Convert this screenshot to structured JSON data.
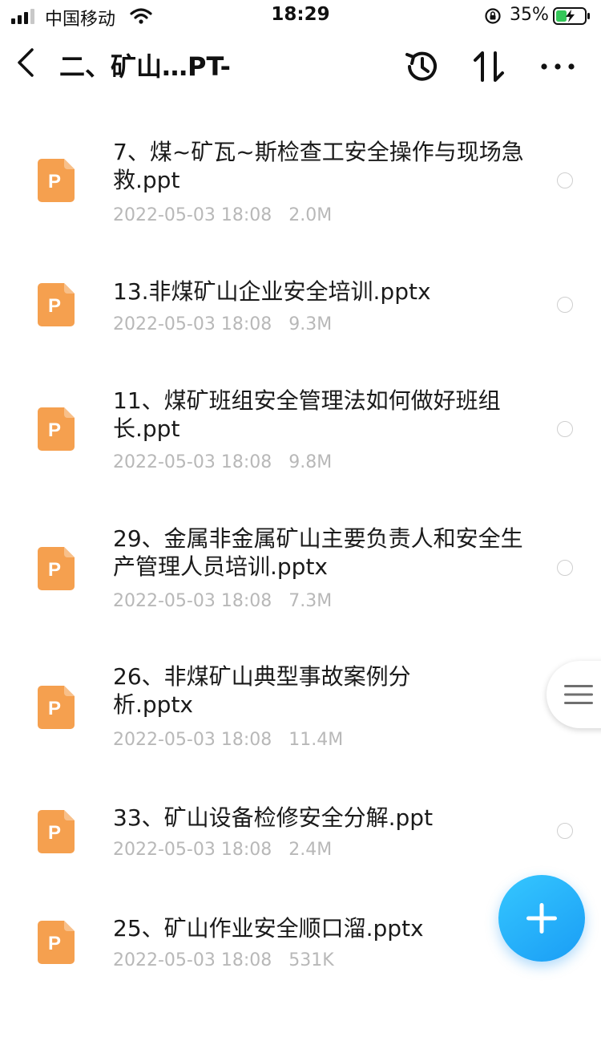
{
  "status_bar": {
    "carrier": "中国移动",
    "time": "18:29",
    "battery_percent": "35%",
    "icons": [
      "signal-icon",
      "wifi-icon",
      "orientation-lock-icon",
      "battery-charging-icon"
    ]
  },
  "nav": {
    "title": "二、矿山…PT-",
    "icons": [
      "back-chevron-icon",
      "history-icon",
      "sort-icon",
      "more-icon"
    ]
  },
  "files": [
    {
      "name": "7、煤~矿瓦~斯检查工安全操作与现场急救.ppt",
      "date": "2022-05-03 18:08",
      "size": "2.0M"
    },
    {
      "name": "13.非煤矿山企业安全培训.pptx",
      "date": "2022-05-03 18:08",
      "size": "9.3M"
    },
    {
      "name": "11、煤矿班组安全管理法如何做好班组长.ppt",
      "date": "2022-05-03 18:08",
      "size": "9.8M"
    },
    {
      "name": "29、金属非金属矿山主要负责人和安全生产管理人员培训.pptx",
      "date": "2022-05-03 18:08",
      "size": "7.3M"
    },
    {
      "name": "26、非煤矿山典型事故案例分析.pptx",
      "date": "2022-05-03 18:08",
      "size": "11.4M"
    },
    {
      "name": "33、矿山设备检修安全分解.ppt",
      "date": "2022-05-03 18:08",
      "size": "2.4M"
    },
    {
      "name": "25、矿山作业安全顺口溜.pptx",
      "date": "2022-05-03 18:08",
      "size": "531K"
    }
  ],
  "file_icon": {
    "name": "ppt-file-icon",
    "letter": "P",
    "color": "#f5a04f"
  },
  "side_tab": {
    "icon": "menu-lines-icon"
  },
  "fab": {
    "icon": "plus-icon",
    "color": "#1fa8f7"
  }
}
